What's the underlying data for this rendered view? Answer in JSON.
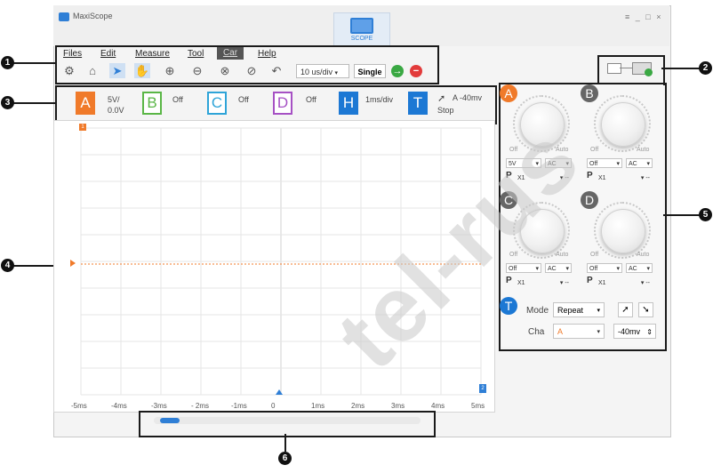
{
  "app": {
    "title": "MaxiScope",
    "window_controls": "≡ _ □ ×",
    "active_tab": "SCOPE"
  },
  "callouts": [
    "1",
    "2",
    "3",
    "4",
    "5",
    "6"
  ],
  "menu": [
    "Files",
    "Edit",
    "Measure",
    "Tool",
    "Car",
    "Help"
  ],
  "toolbar": {
    "icons": [
      "gear-icon",
      "home-icon",
      "pointer-icon",
      "hand-icon",
      "zoom-in-icon",
      "zoom-out-icon",
      "zoom-x-icon",
      "zoom-y-icon",
      "undo-icon"
    ],
    "timebase": "10 us/div",
    "single_label": "Single",
    "run_icon": "play-icon",
    "stop_icon": "stop-icon"
  },
  "channels": [
    {
      "letter": "A",
      "line1": "5V/",
      "line2": "0.0V",
      "color": "#f07a2a",
      "filled": true
    },
    {
      "letter": "B",
      "line1": "Off",
      "line2": "",
      "color": "#5ab646",
      "filled": false
    },
    {
      "letter": "C",
      "line1": "Off",
      "line2": "",
      "color": "#2ea4d8",
      "filled": false
    },
    {
      "letter": "D",
      "line1": "Off",
      "line2": "",
      "color": "#a651c4",
      "filled": false
    },
    {
      "letter": "H",
      "line1": "1ms/div",
      "line2": "",
      "color": "#1c78d4",
      "filled": true
    },
    {
      "letter": "T",
      "line1": "A  -40mv",
      "line2": "Stop",
      "color": "#1c78d4",
      "filled": true
    }
  ],
  "plot": {
    "x_ticks": [
      "-5ms",
      "-4ms",
      "-3ms",
      "- 2ms",
      "-1ms",
      "0",
      "1ms",
      "2ms",
      "3ms",
      "4ms",
      "5ms"
    ],
    "trace_color": "#f07a2a",
    "marker_top": "1",
    "marker_bottom": "2"
  },
  "channel_panel": [
    {
      "letter": "A",
      "color": "#f07a2a",
      "off": "Off",
      "auto": "Auto",
      "volt": "5V",
      "coupling": "AC",
      "probe": "X1"
    },
    {
      "letter": "B",
      "color": "#666666",
      "off": "Off",
      "auto": "Auto",
      "volt": "Off",
      "coupling": "AC",
      "probe": "X1"
    },
    {
      "letter": "C",
      "color": "#666666",
      "off": "Off",
      "auto": "Auto",
      "volt": "Off",
      "coupling": "AC",
      "probe": "X1"
    },
    {
      "letter": "D",
      "color": "#666666",
      "off": "Off",
      "auto": "Auto",
      "volt": "Off",
      "coupling": "AC",
      "probe": "X1"
    }
  ],
  "trigger": {
    "badge": "T",
    "mode_label": "Mode",
    "mode_value": "Repeat",
    "cha_label": "Cha",
    "cha_value": "A",
    "level_value": "-40mv"
  },
  "watermark": "tel-rus"
}
